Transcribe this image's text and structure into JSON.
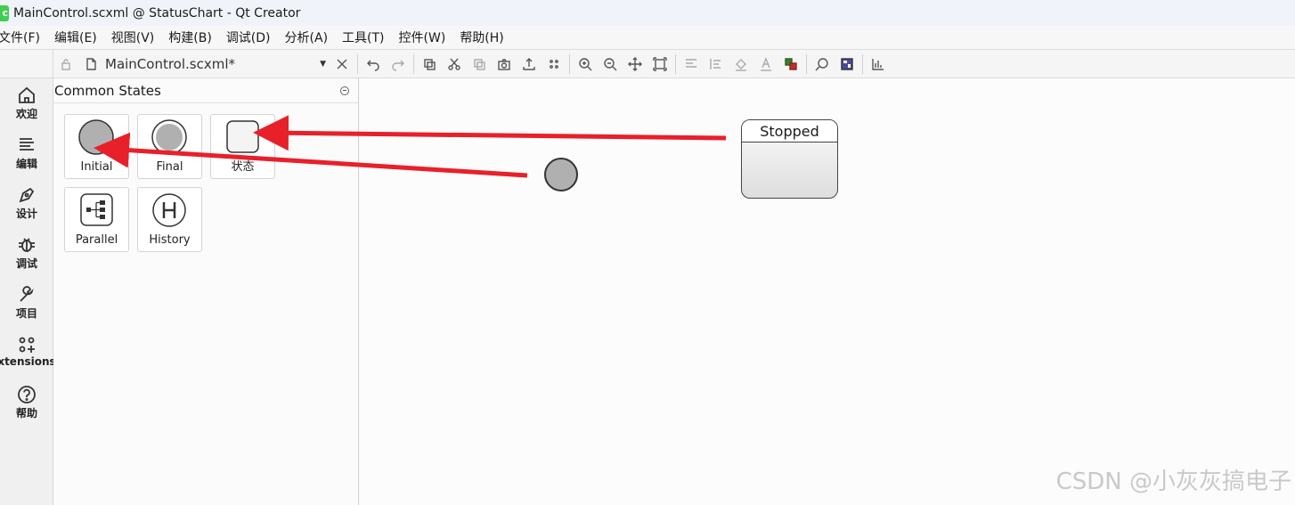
{
  "window": {
    "title": "MainControl.scxml @ StatusChart - Qt Creator",
    "app_icon_letter": "c"
  },
  "menu": [
    "文件(F)",
    "编辑(E)",
    "视图(V)",
    "构建(B)",
    "调试(D)",
    "分析(A)",
    "工具(T)",
    "控件(W)",
    "帮助(H)"
  ],
  "toolbar": {
    "file_name": "MainControl.scxml*"
  },
  "sidebar": {
    "items": [
      {
        "label": "欢迎",
        "icon": "home-icon"
      },
      {
        "label": "编辑",
        "icon": "edit-lines-icon"
      },
      {
        "label": "设计",
        "icon": "design-pen-icon"
      },
      {
        "label": "调试",
        "icon": "bug-icon"
      },
      {
        "label": "项目",
        "icon": "wrench-icon"
      },
      {
        "label": "xtensions",
        "icon": "extensions-grid-icon"
      },
      {
        "label": "帮助",
        "icon": "help-icon"
      }
    ]
  },
  "palette": {
    "title": "Common States",
    "tiles": [
      {
        "label": "Initial"
      },
      {
        "label": "Final"
      },
      {
        "label": "状态"
      },
      {
        "label": "Parallel"
      },
      {
        "label": "History"
      }
    ]
  },
  "canvas": {
    "state_name": "Stopped"
  },
  "watermark": "CSDN @小灰灰搞电子",
  "colors": {
    "annotation_arrow": "#e8202a",
    "initial_fill": "#b0b0b0"
  }
}
